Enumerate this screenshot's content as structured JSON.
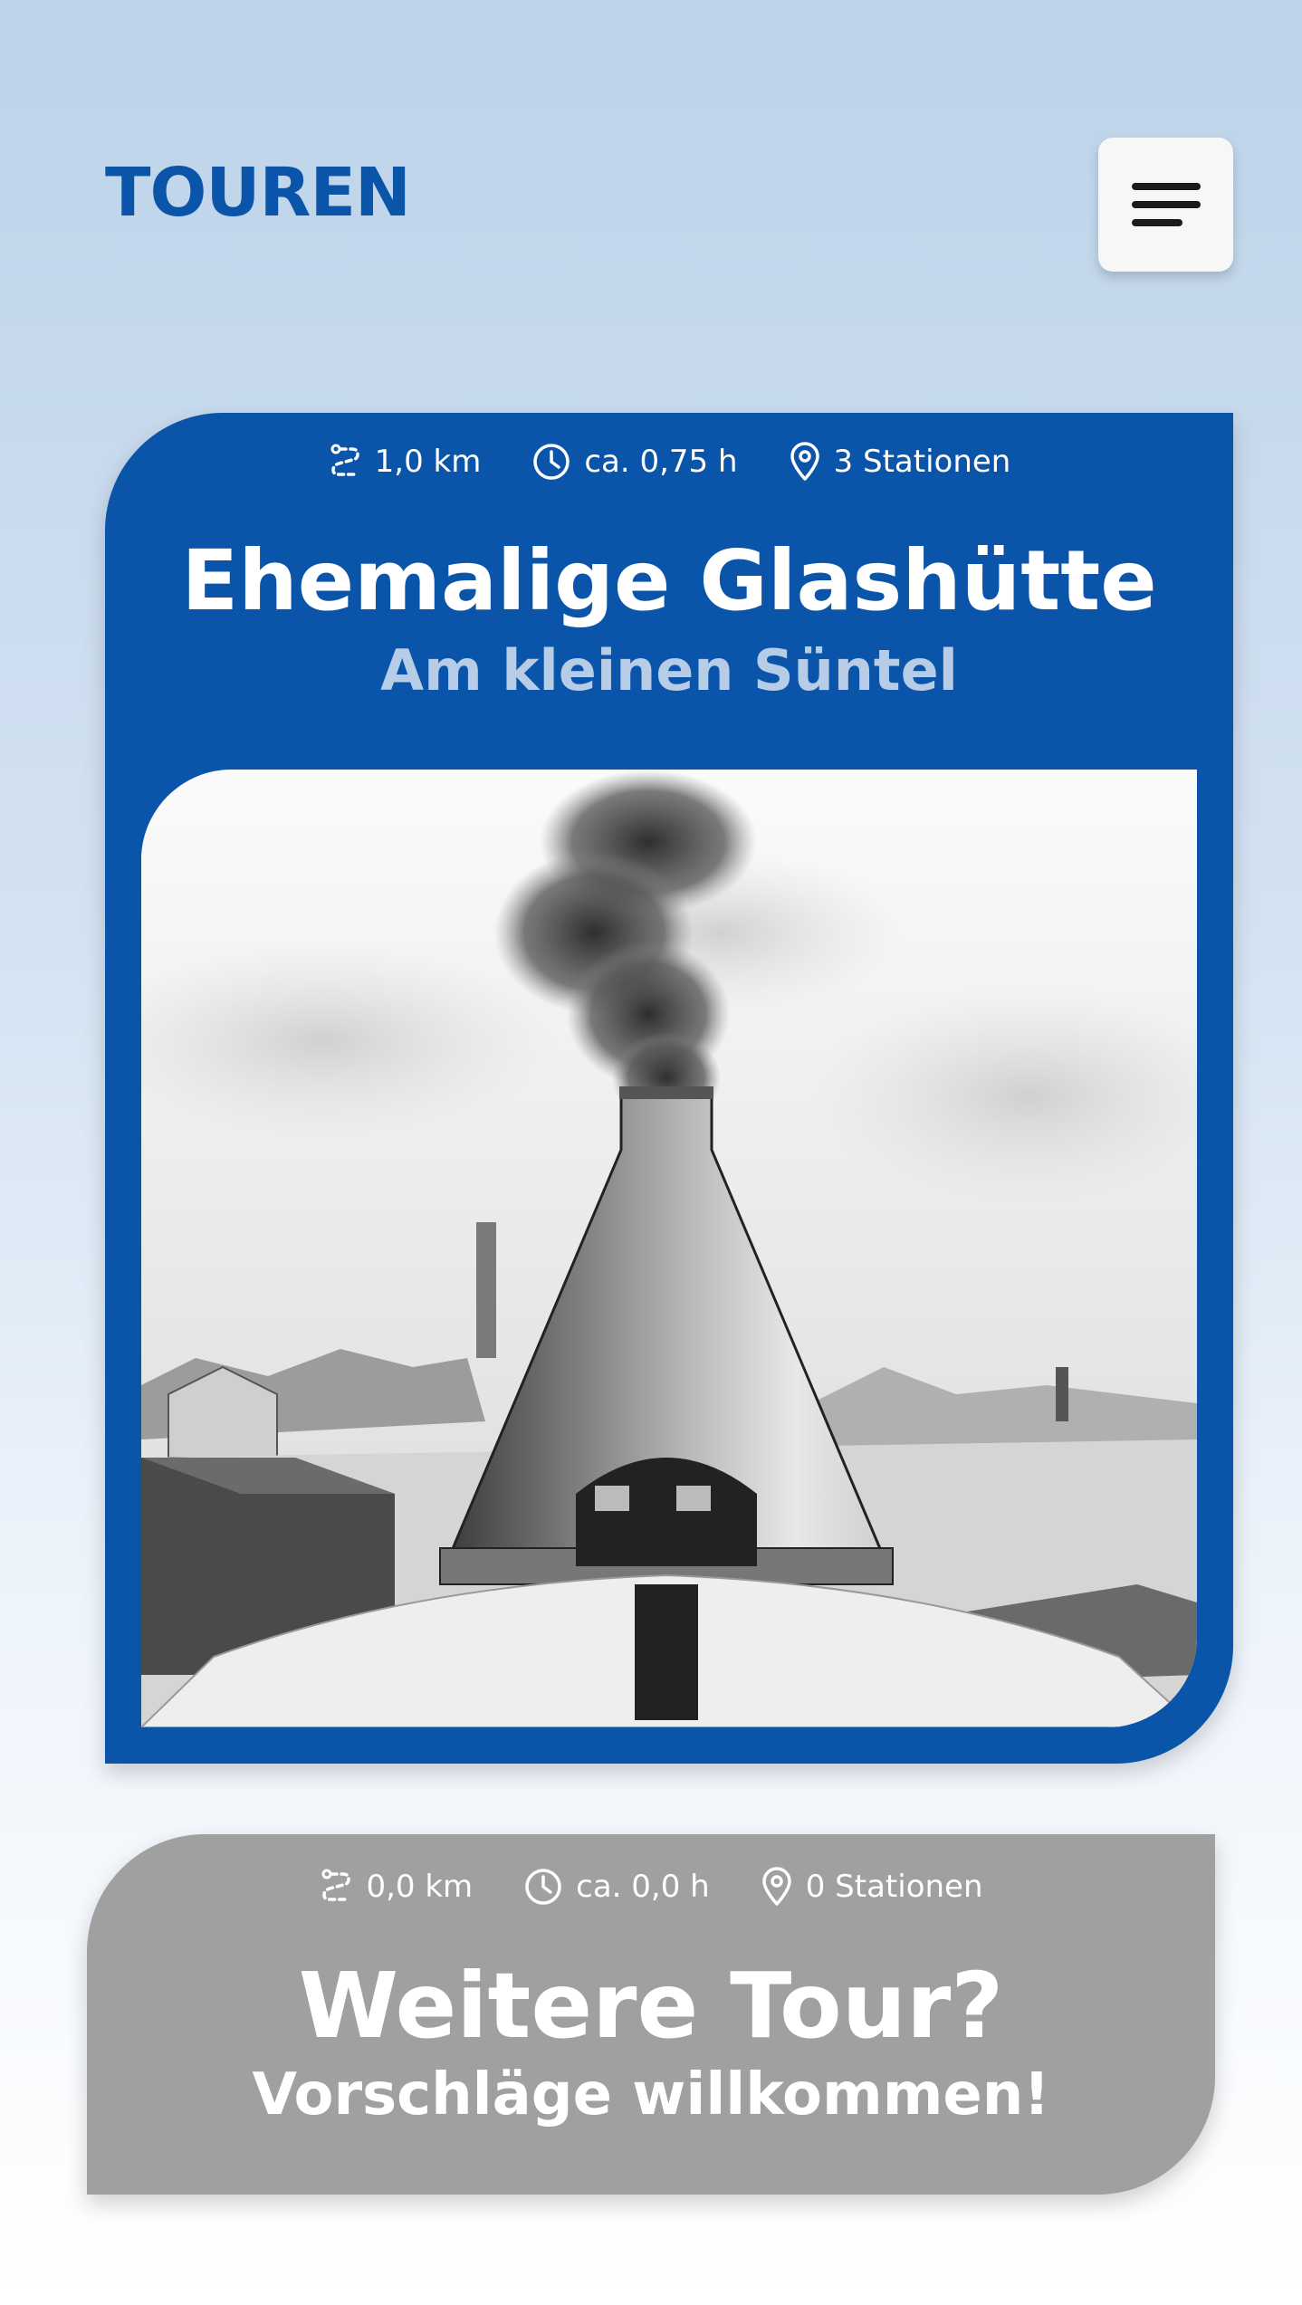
{
  "header": {
    "title": "TOUREN",
    "menu_icon": "hamburger-menu-icon"
  },
  "tours": [
    {
      "distance": "1,0 km",
      "duration": "ca. 0,75 h",
      "stations": "3 Stationen",
      "title": "Ehemalige Glashütte",
      "subtitle": "Am kleinen Süntel",
      "color": "#0a55aa",
      "subtitle_color": "#b7cde7",
      "image": "glass-furnace-engraving"
    },
    {
      "distance": "0,0 km",
      "duration": "ca. 0,0 h",
      "stations": "0 Stationen",
      "title": "Weitere Tour?",
      "subtitle": "Vorschläge willkommen!",
      "color": "#a0a0a0"
    }
  ],
  "icons": {
    "distance": "route-icon",
    "duration": "clock-icon",
    "stations": "map-pin-icon"
  },
  "colors": {
    "accent": "#0a55aa",
    "menu_button_bg": "#f7f7f7",
    "inactive_card": "#a0a0a0"
  }
}
